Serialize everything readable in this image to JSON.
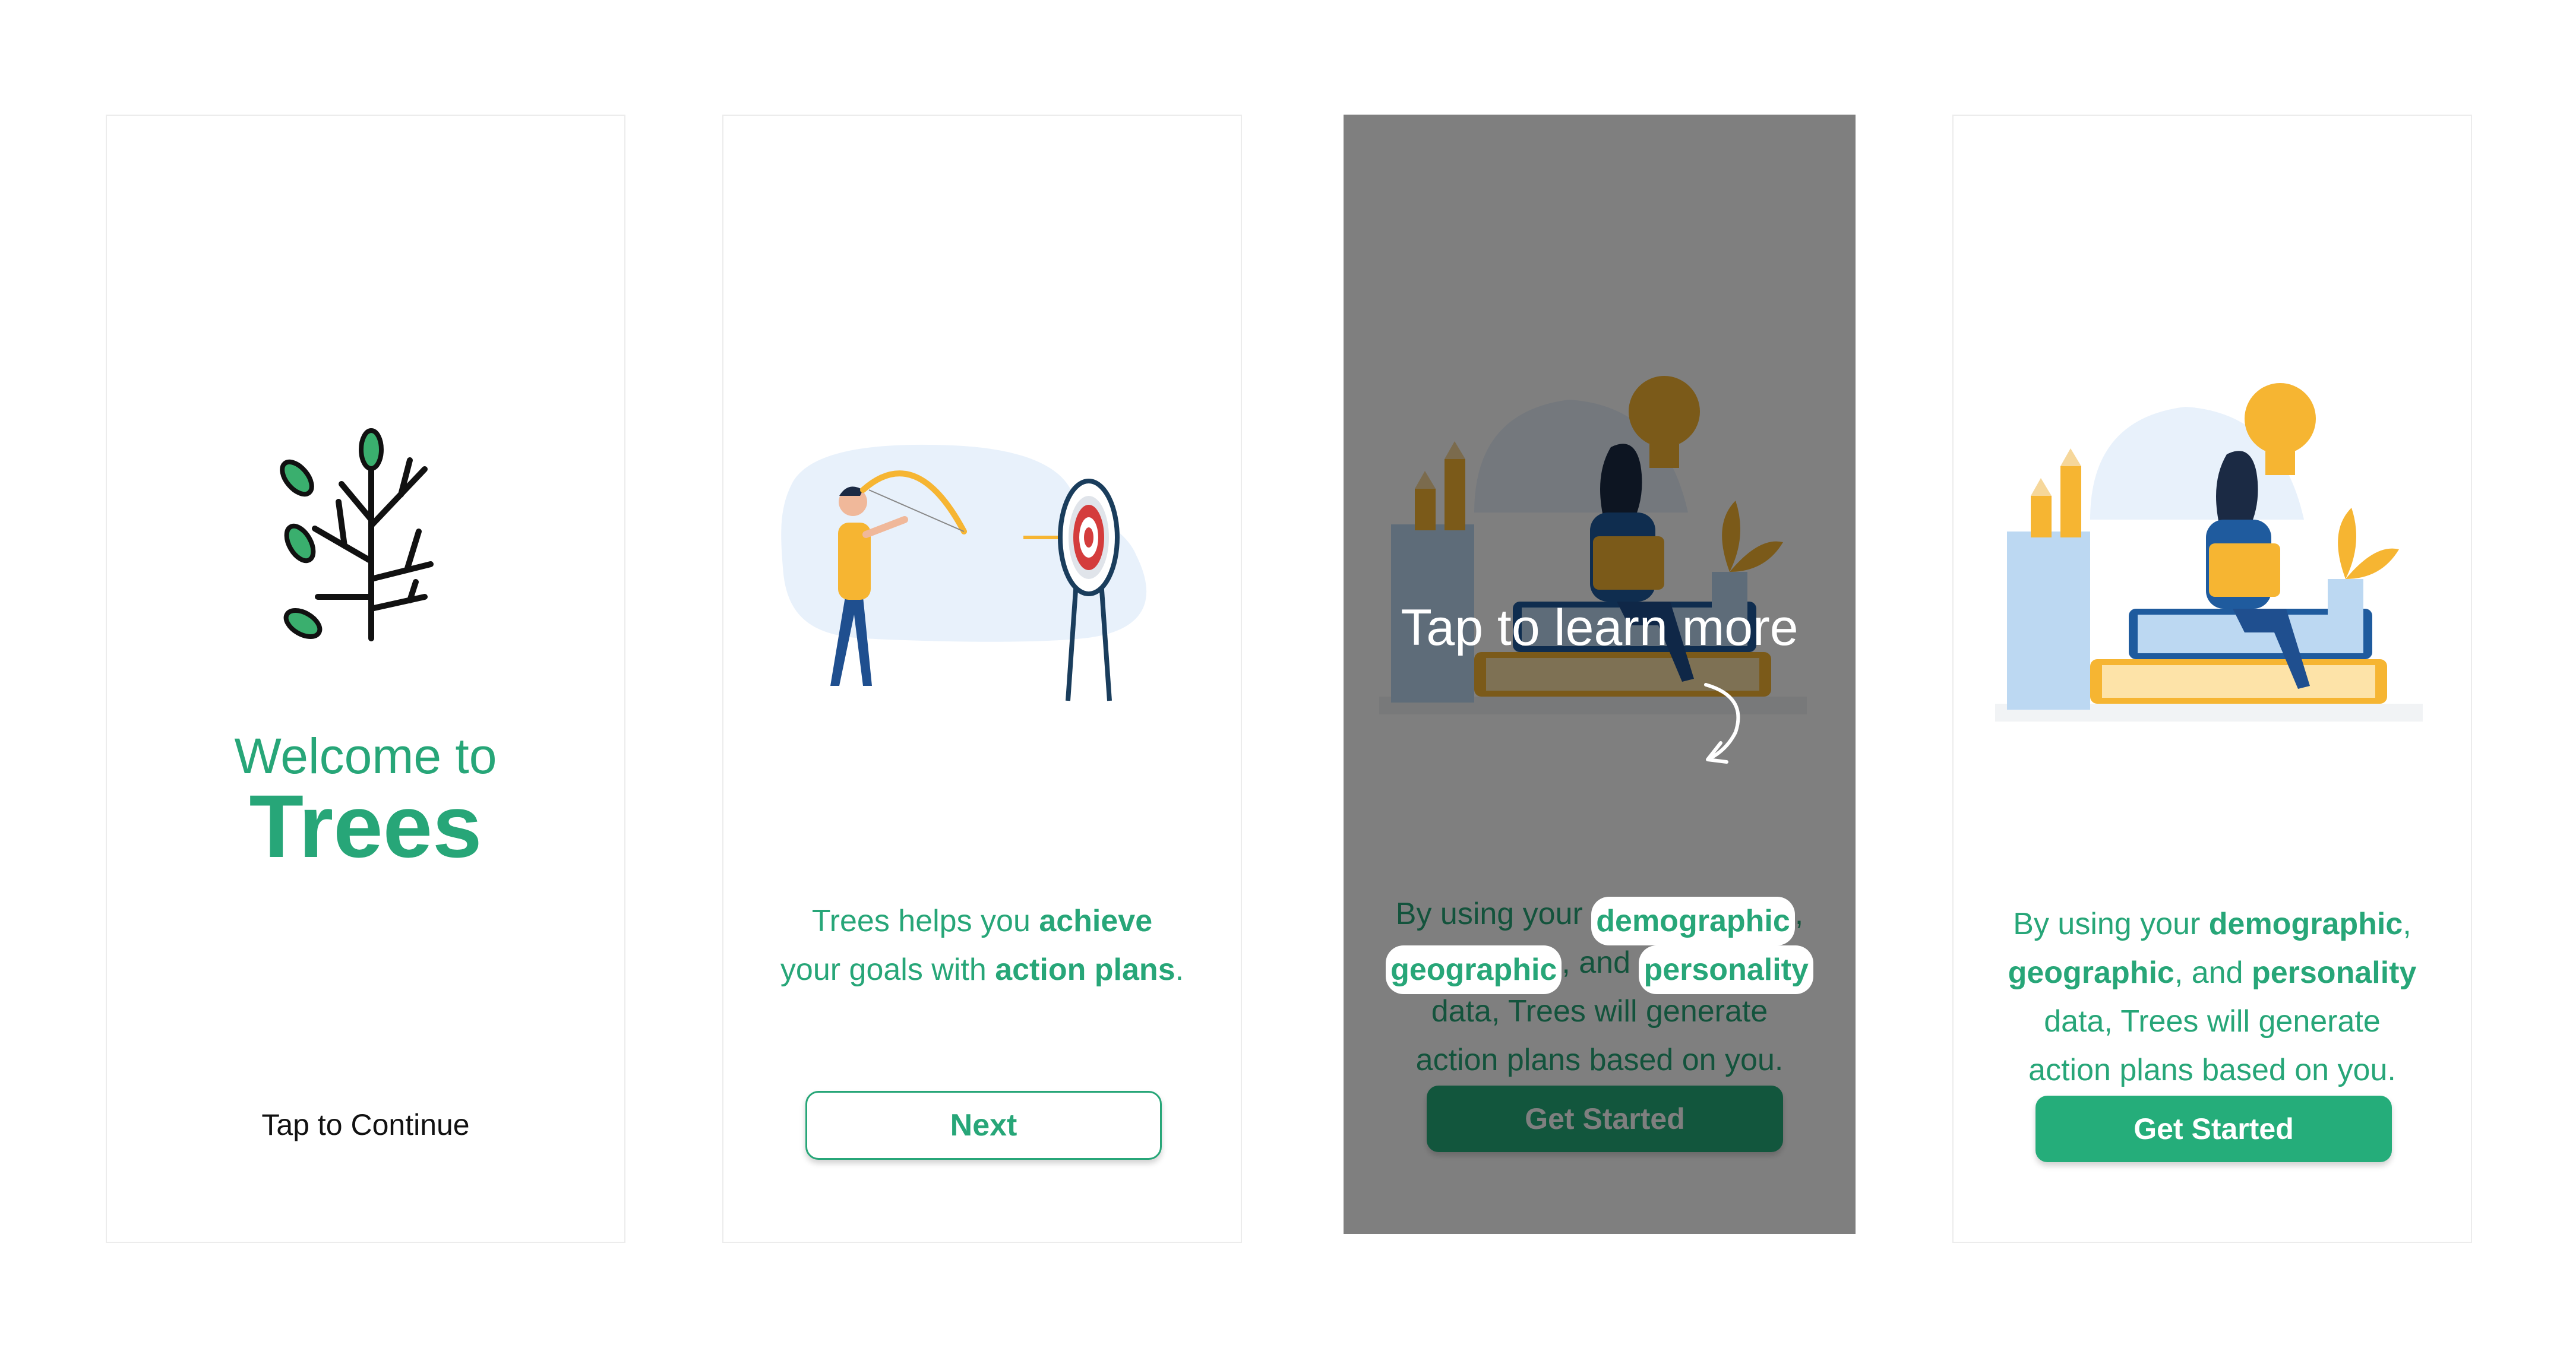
{
  "screens": {
    "welcome": {
      "line1": "Welcome to",
      "brand": "Trees",
      "tap_continue": "Tap to Continue"
    },
    "goals": {
      "text_pre": "Trees helps you ",
      "text_b1": "achieve",
      "text_mid": "your goals with ",
      "text_b2": "action plans",
      "text_end": ".",
      "next_label": "Next"
    },
    "coach": {
      "tooltip": "Tap to learn more",
      "t1": "By using your ",
      "b1": "demographic",
      "t2": ",",
      "b2": "geographic",
      "t3": ", and ",
      "b3": "personality",
      "line3": "data, Trees will generate",
      "line4": "action plans based on you.",
      "button_label": "Get Started"
    },
    "final": {
      "t1": "By using your ",
      "b1": "demographic",
      "t2": ",",
      "b2": "geographic",
      "t3": ", and ",
      "b3": "personality",
      "line3": "data, Trees will generate",
      "line4": "action plans based on you.",
      "button_label": "Get Started"
    }
  },
  "colors": {
    "brand_green": "#27a678",
    "button_green": "#25ad7a",
    "overlay": "rgba(0,0,0,0.5)",
    "illustration_yellow": "#f6b532",
    "illustration_blue": "#1f5b9e"
  },
  "icons": [
    "tree-logo-icon",
    "archer-illustration",
    "study-illustration",
    "curved-arrow-icon"
  ]
}
